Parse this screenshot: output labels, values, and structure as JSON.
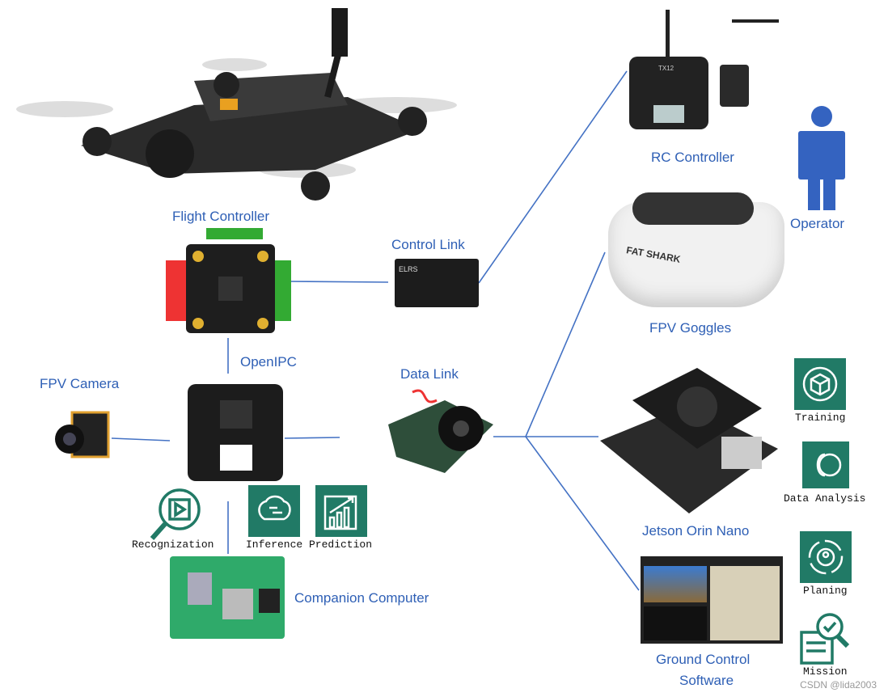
{
  "labels": {
    "flight_controller": "Flight Controller",
    "control_link": "Control Link",
    "rc_controller": "RC Controller",
    "operator": "Operator",
    "fpv_goggles": "FPV Goggles",
    "openipc": "OpenIPC",
    "fpv_camera": "FPV Camera",
    "data_link": "Data Link",
    "jetson": "Jetson Orin Nano",
    "companion": "Companion Computer",
    "gcs_line1": "Ground Control",
    "gcs_line2": "Software"
  },
  "tasks": {
    "recognization": "Recognization",
    "inference": "Inference",
    "prediction": "Prediction",
    "training": "Training",
    "data_analysis": "Data Analysis",
    "planing": "Planing",
    "mission": "Mission"
  },
  "image_text": {
    "goggles_brand": "FAT SHARK",
    "rc_model": "TX12",
    "elrs": "ELRS"
  },
  "watermark": "CSDN @lida2003",
  "colors": {
    "line": "#4472c4",
    "label": "#2e5fb5",
    "tile": "#217a66"
  }
}
